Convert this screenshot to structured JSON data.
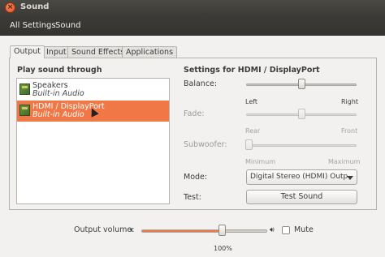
{
  "window": {
    "title": "Sound",
    "close_icon": "close-icon"
  },
  "toolbar": {
    "all_settings": "All Settings",
    "sound": "Sound"
  },
  "tabs": [
    {
      "label": "Output",
      "active": true
    },
    {
      "label": "Input",
      "active": false
    },
    {
      "label": "Sound Effects",
      "active": false
    },
    {
      "label": "Applications",
      "active": false
    }
  ],
  "output": {
    "list_title": "Play sound through",
    "devices": [
      {
        "name": "Speakers",
        "sub": "Built-in Audio",
        "selected": false
      },
      {
        "name": "HDMI / DisplayPort",
        "sub": "Built-in Audio",
        "selected": true
      }
    ],
    "settings_title": "Settings for HDMI / DisplayPort",
    "balance": {
      "label": "Balance:",
      "left": "Left",
      "right": "Right",
      "value": 0.5
    },
    "fade": {
      "label": "Fade:",
      "left": "Rear",
      "right": "Front",
      "value": 0.5,
      "enabled": false
    },
    "subwoofer": {
      "label": "Subwoofer:",
      "left": "Minimum",
      "right": "Maximum",
      "value": 0.0,
      "enabled": false
    },
    "mode": {
      "label": "Mode:",
      "value": "Digital Stereo (HDMI) Output"
    },
    "test": {
      "label": "Test:",
      "button": "Test Sound"
    }
  },
  "volume": {
    "label": "Output volume:",
    "percent_text": "100%",
    "level": 0.63,
    "mute_label": "Mute",
    "muted": false
  },
  "colors": {
    "accent": "#f07746",
    "titlebar": "#3c3b37",
    "background": "#f2f1f0"
  }
}
